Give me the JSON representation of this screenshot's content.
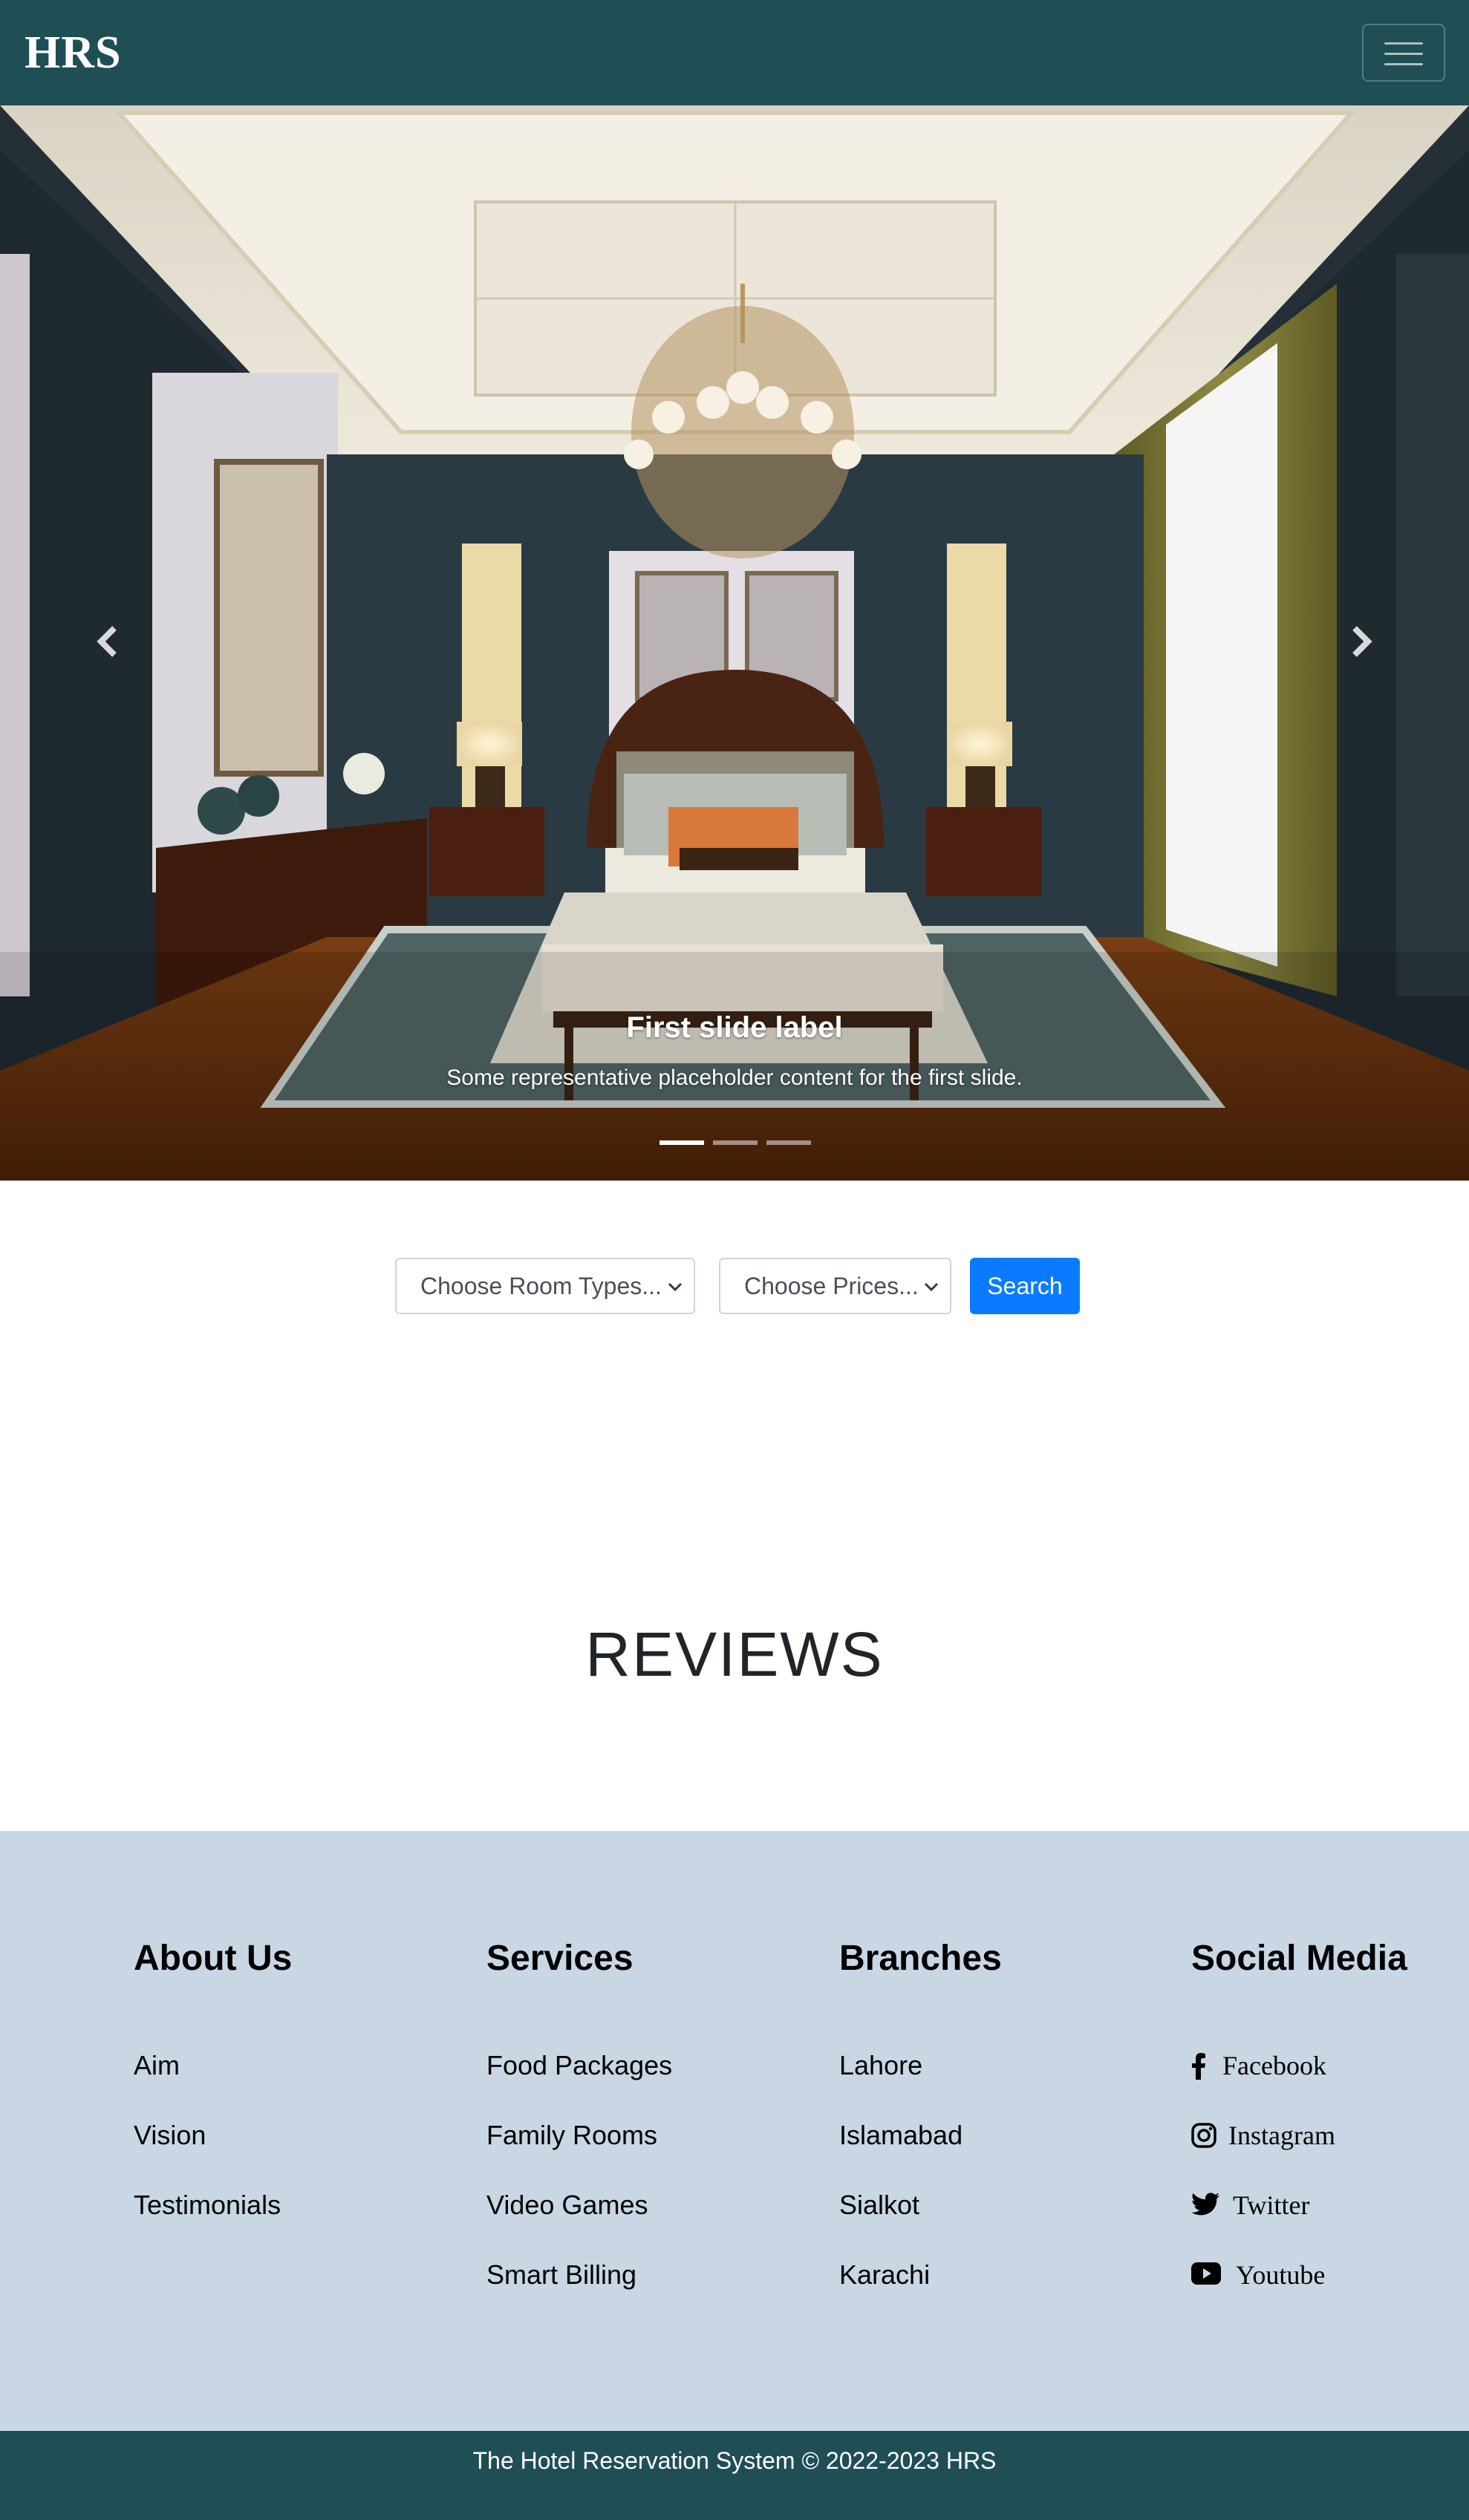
{
  "navbar": {
    "brand": "HRS",
    "toggle_icon": "hamburger-menu-icon"
  },
  "carousel": {
    "caption_title": "First slide label",
    "caption_text": "Some representative placeholder content for the first slide.",
    "slide_count": 3,
    "active_slide": 1,
    "prev_icon": "chevron-left-icon",
    "next_icon": "chevron-right-icon"
  },
  "search": {
    "room_type_selected": "Choose Room Types...",
    "price_selected": "Choose Prices...",
    "button_label": "Search"
  },
  "reviews": {
    "heading": "REVIEWS"
  },
  "footer": {
    "about": {
      "title": "About Us",
      "links": [
        "Aim",
        "Vision",
        "Testimonials"
      ]
    },
    "services": {
      "title": "Services",
      "links": [
        "Food Packages",
        "Family Rooms",
        "Video Games",
        "Smart Billing"
      ]
    },
    "branches": {
      "title": "Branches",
      "links": [
        "Lahore",
        "Islamabad",
        "Sialkot",
        "Karachi"
      ]
    },
    "social": {
      "title": "Social Media",
      "links": [
        {
          "label": "Facebook",
          "icon": "facebook-icon"
        },
        {
          "label": "Instagram",
          "icon": "instagram-icon"
        },
        {
          "label": "Twitter",
          "icon": "twitter-icon"
        },
        {
          "label": "Youtube",
          "icon": "youtube-icon"
        }
      ]
    },
    "copyright": "The Hotel Reservation System © 2022-2023 HRS"
  },
  "colors": {
    "navbar_bg": "#1f4e55",
    "footer_bg": "#c8d7e3",
    "primary_button": "#0a7bff"
  }
}
